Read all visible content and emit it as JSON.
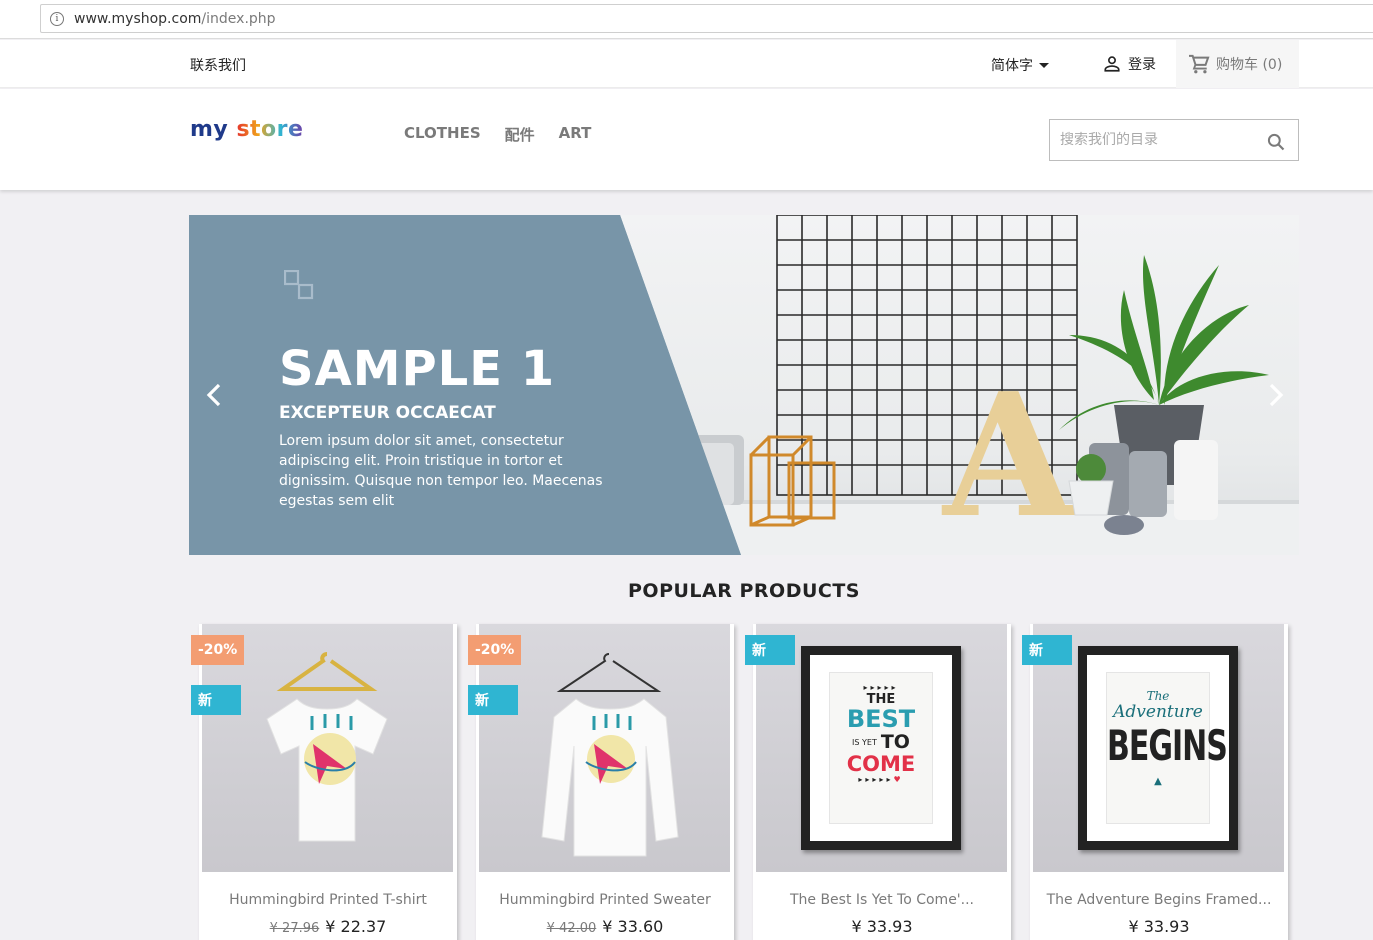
{
  "browser": {
    "url_domain": "www.myshop.com",
    "url_path": "/index.php"
  },
  "topnav": {
    "contact": "联系我们",
    "language": "简体字",
    "login": "登录",
    "cart": "购物车 (0)"
  },
  "header": {
    "logo_part1": "my",
    "logo_part2": "store",
    "menu": [
      "CLOTHES",
      "配件",
      "ART"
    ],
    "search_placeholder": "搜索我们的目录"
  },
  "slider": {
    "title": "SAMPLE 1",
    "subtitle": "EXCEPTEUR OCCAECAT",
    "description": "Lorem ipsum dolor sit amet, consectetur adipiscing elit. Proin tristique in tortor et dignissim. Quisque non tempor leo. Maecenas egestas sem elit",
    "letter": "A",
    "accent": "#7895a8"
  },
  "section_title": "POPULAR PRODUCTS",
  "products": [
    {
      "name": "Hummingbird Printed T-shirt",
      "discount": "-20%",
      "new": "新",
      "regular_price": "¥ 27.96",
      "price": "¥ 22.37"
    },
    {
      "name": "Hummingbird Printed Sweater",
      "discount": "-20%",
      "new": "新",
      "regular_price": "¥ 42.00",
      "price": "¥ 33.60"
    },
    {
      "name": "The Best Is Yet To Come'...",
      "new": "新",
      "price": "¥ 33.93",
      "poster_lines": [
        "THE",
        "BEST",
        "IS YET",
        "TO",
        "COME"
      ]
    },
    {
      "name": "The Adventure Begins Framed...",
      "new": "新",
      "price": "¥ 33.93",
      "poster_lines": [
        "The",
        "Adventure",
        "BEGINS"
      ]
    }
  ],
  "colors": {
    "discount": "#f39d72",
    "new": "#2fb5d2",
    "menu": "#7a7a7a"
  }
}
